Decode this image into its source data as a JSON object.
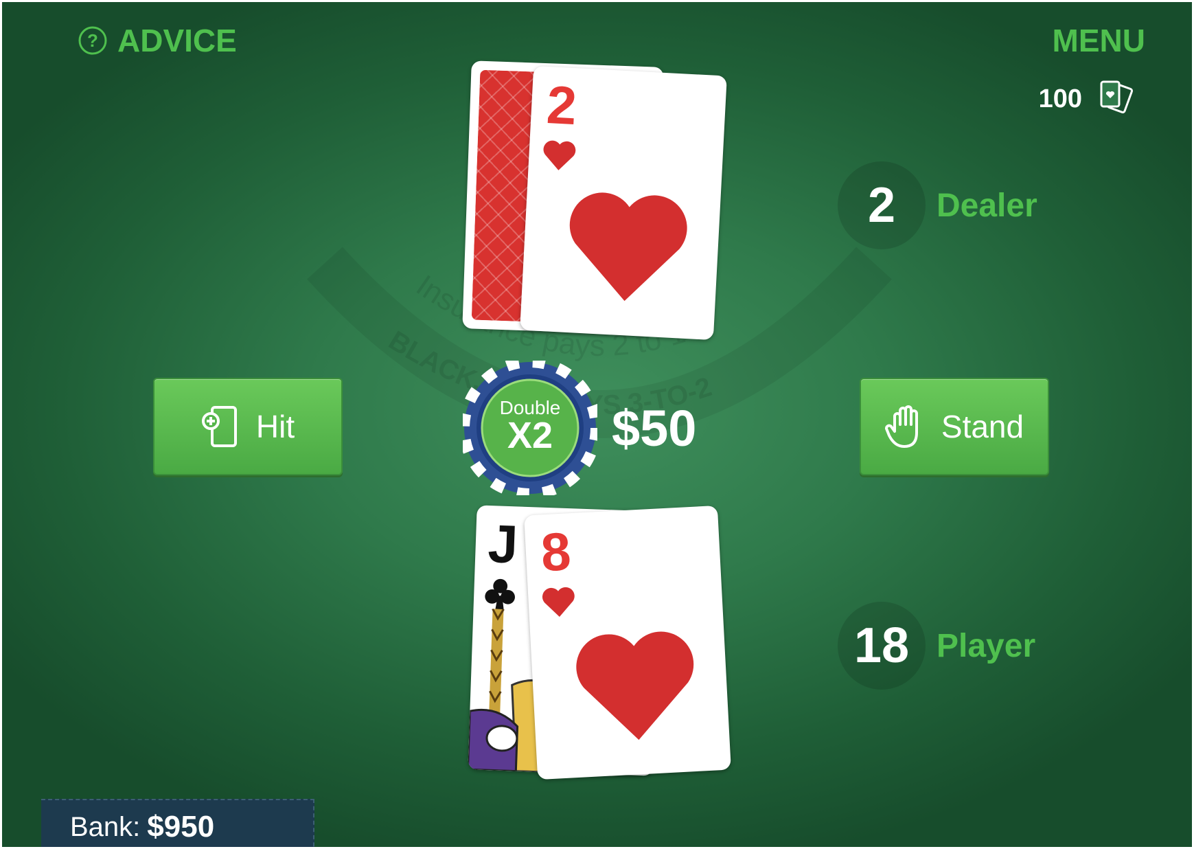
{
  "header": {
    "advice_label": "ADVICE",
    "menu_label": "MENU",
    "deck_count": "100"
  },
  "table_text": {
    "insurance": "Insurance pays 2 to 1",
    "blackjack": "BLACKJACK PAYS 3-TO-2"
  },
  "dealer": {
    "score": "2",
    "label": "Dealer",
    "cards": [
      {
        "face": "down"
      },
      {
        "rank": "2",
        "suit": "hearts"
      }
    ]
  },
  "player": {
    "score": "18",
    "label": "Player",
    "cards": [
      {
        "rank": "J",
        "suit": "clubs"
      },
      {
        "rank": "8",
        "suit": "hearts"
      }
    ]
  },
  "actions": {
    "hit_label": "Hit",
    "stand_label": "Stand"
  },
  "bet": {
    "chip_line1": "Double",
    "chip_line2": "X2",
    "amount": "$50"
  },
  "bank": {
    "label": "Bank:",
    "value": "$950"
  },
  "colors": {
    "felt": "#2f7a4b",
    "accent_green": "#4fc04e",
    "heart_red": "#d32f2f",
    "chip_blue": "#2e4f94",
    "bank_bg": "#1d3a4e"
  },
  "icons": {
    "advice": "question-circle-icon",
    "deck": "cards-icon",
    "hit": "add-card-icon",
    "stand": "hand-icon"
  }
}
